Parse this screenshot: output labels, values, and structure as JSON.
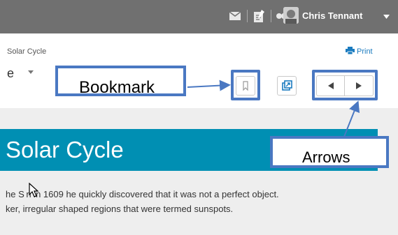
{
  "header": {
    "user_name": "Chris Tennant",
    "icons": [
      "envelope-icon",
      "clipboard-icon",
      "chat-icon",
      "chevron-down-icon"
    ],
    "bar_color": "#707070"
  },
  "breadcrumb": {
    "text": "Solar Cycle"
  },
  "print": {
    "label": "Print"
  },
  "title_fragment": {
    "text": "e"
  },
  "banner": {
    "title": "Solar Cycle",
    "color": "#008fb3"
  },
  "content": {
    "line1": "he S n in 1609 he quickly discovered that it was not a perfect object.",
    "line2": "ker, irregular shaped regions that were termed sunspots."
  },
  "annotations": {
    "bookmark_label": "Bookmark",
    "arrows_label": "Arrows",
    "color": "#4a78c2"
  }
}
